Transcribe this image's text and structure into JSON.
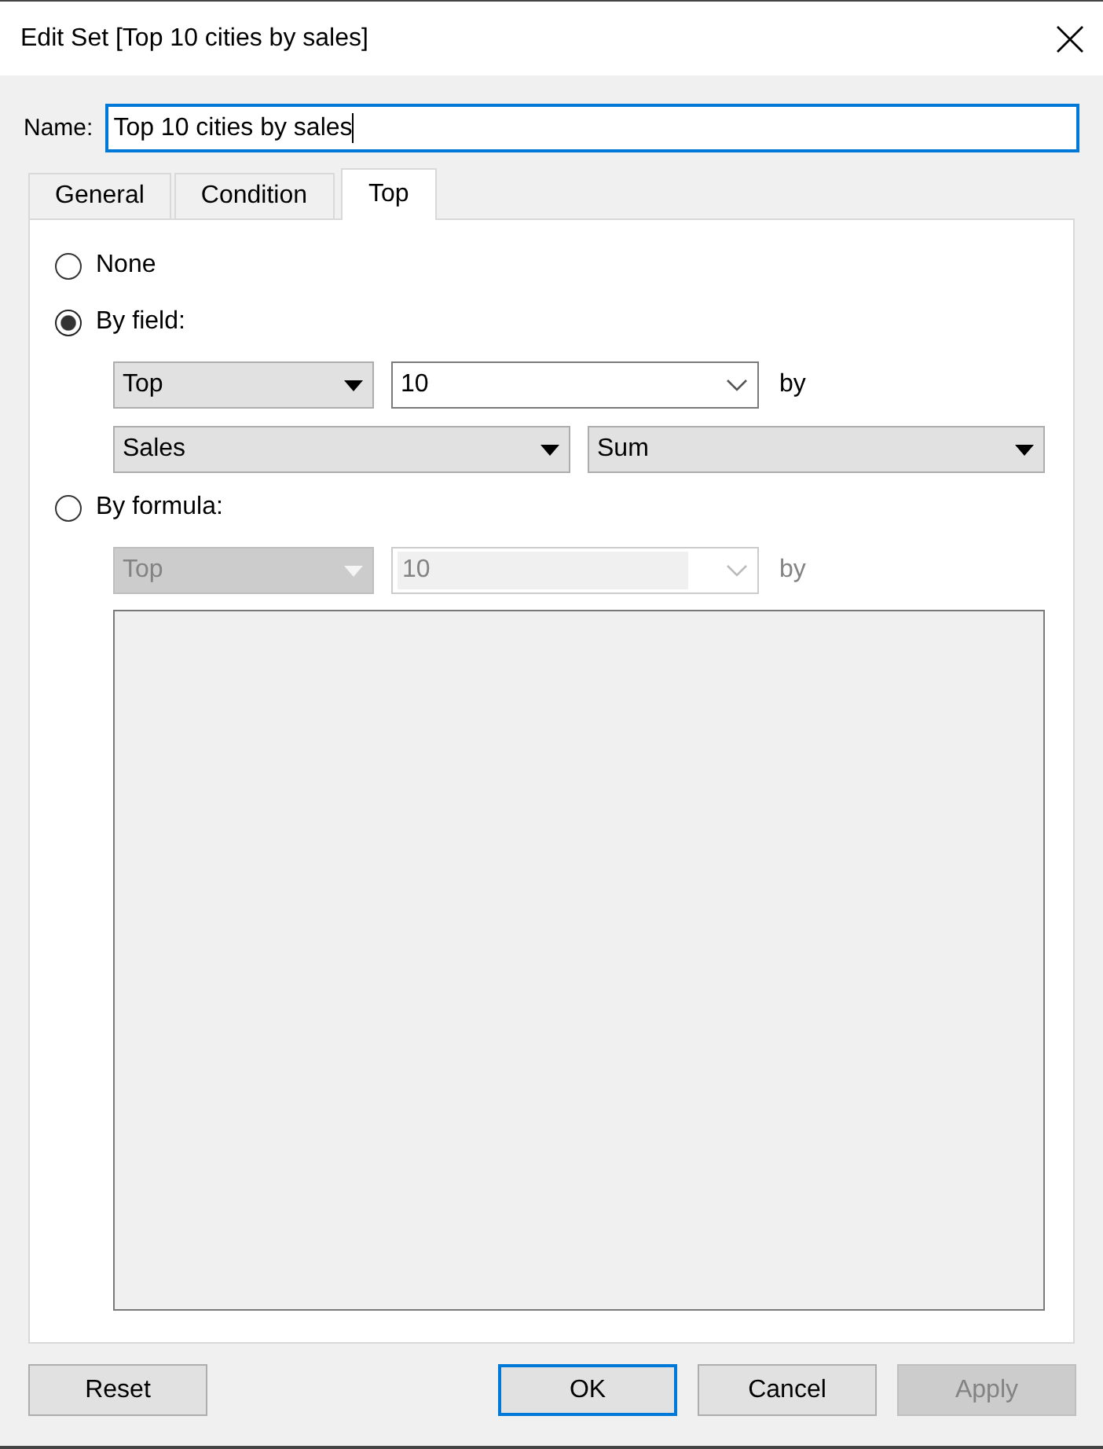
{
  "window": {
    "title": "Edit Set [Top 10 cities by sales]"
  },
  "name_field": {
    "label": "Name:",
    "value": "Top 10 cities by sales",
    "focused": true
  },
  "tabs": [
    {
      "label": "General",
      "selected": false
    },
    {
      "label": "Condition",
      "selected": false
    },
    {
      "label": "Top",
      "selected": true
    }
  ],
  "options": [
    {
      "label": "None",
      "selected": false
    },
    {
      "label": "By field:",
      "selected": true,
      "rows": [
        [
          {
            "kind": "dropdown",
            "value": "Top",
            "disabled": false
          },
          {
            "kind": "combo",
            "value": "10",
            "disabled": false
          },
          {
            "kind": "text",
            "text": "by",
            "disabled": false
          }
        ],
        [
          {
            "kind": "dropdown",
            "value": "Sales",
            "disabled": false
          },
          {
            "kind": "dropdown",
            "value": "Sum",
            "disabled": false
          }
        ]
      ]
    },
    {
      "label": "By formula:",
      "selected": false,
      "rows": [
        [
          {
            "kind": "dropdown",
            "value": "Top",
            "disabled": true
          },
          {
            "kind": "combo",
            "value": "10",
            "disabled": true
          },
          {
            "kind": "text",
            "text": "by",
            "disabled": true
          }
        ]
      ],
      "formula_box": {
        "disabled": true
      }
    }
  ],
  "buttons": [
    {
      "label": "Reset",
      "default": false,
      "disabled": false
    },
    {
      "label": "OK",
      "default": true,
      "disabled": false
    },
    {
      "label": "Cancel",
      "default": false,
      "disabled": false
    },
    {
      "label": "Apply",
      "default": false,
      "disabled": true
    }
  ]
}
